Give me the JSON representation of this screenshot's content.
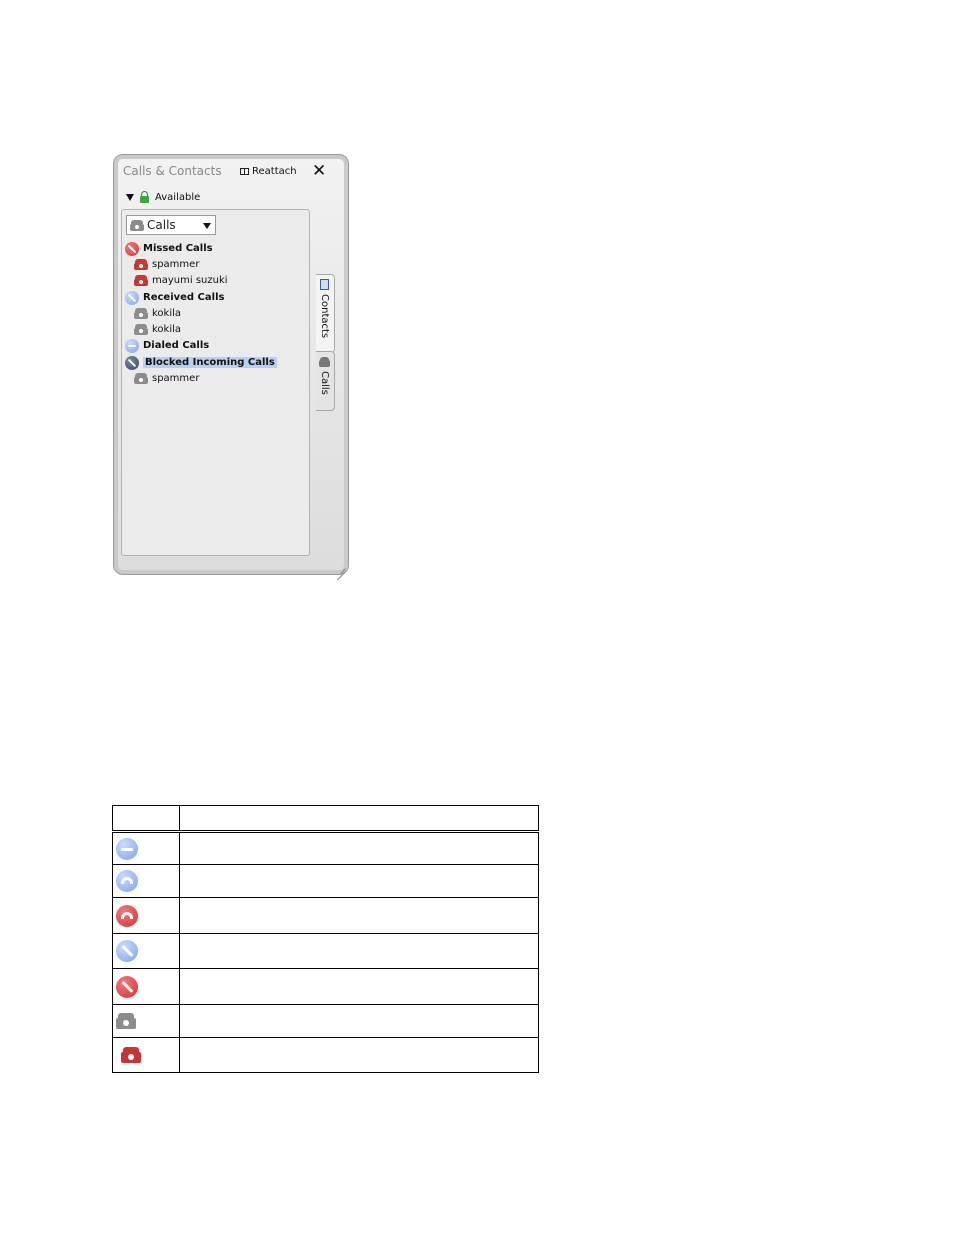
{
  "window": {
    "title": "Calls & Contacts",
    "reattach_label": "Reattach",
    "close_symbol": "✕"
  },
  "status": {
    "label": "Available",
    "icon": "lock-icon",
    "color": "#3ea83e"
  },
  "view_selector": {
    "selected": "Calls"
  },
  "groups": [
    {
      "label": "Missed Calls",
      "icon": "missed-call-icon",
      "entries": [
        "spammer",
        "mayumi suzuki"
      ]
    },
    {
      "label": "Received Calls",
      "icon": "received-call-icon",
      "entries": [
        "kokila",
        "kokila"
      ]
    },
    {
      "label": "Dialed Calls",
      "icon": "dialed-call-icon",
      "entries": []
    },
    {
      "label": "Blocked Incoming Calls",
      "icon": "blocked-call-icon",
      "entries": [
        "spammer"
      ],
      "selected": true
    }
  ],
  "tabs": [
    {
      "label": "Contacts",
      "icon": "address-book-icon"
    },
    {
      "label": "Calls",
      "icon": "phone-icon",
      "active": true
    }
  ],
  "legend_icons": [
    "dialed-call-icon",
    "outgoing-call-icon",
    "missed-hangup-icon",
    "received-call-icon",
    "missed-call-icon",
    "phone-icon",
    "missed-phone-icon"
  ],
  "colors": {
    "missed": "#d83030",
    "received": "#7ea2ea",
    "blocked": "#3b4660",
    "selection": "#b5d0f0"
  }
}
